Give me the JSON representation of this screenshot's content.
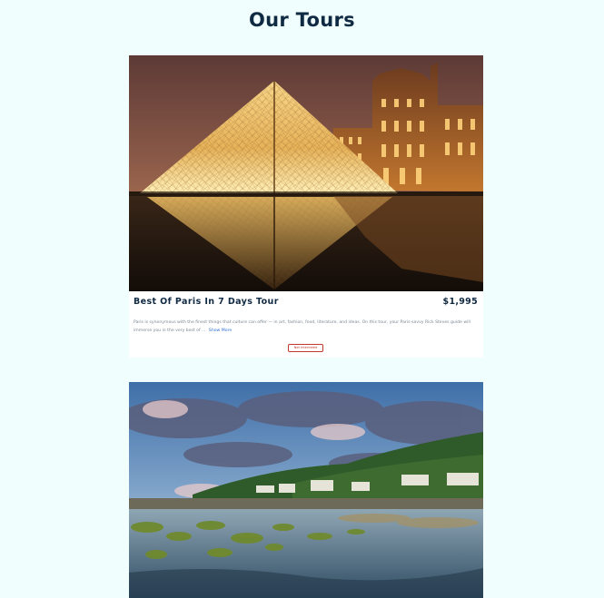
{
  "page": {
    "title": "Our Tours"
  },
  "tours": [
    {
      "name": "Best Of Paris In 7 Days Tour",
      "price": "$1,995",
      "description": "Paris is synonymous with the finest things that culture can offer — in art, fashion, food, literature, and ideas. On this tour, your Paris-savvy Rick Steves guide will immerse you in the very best of ...",
      "show_more_label": "Show More",
      "not_interested_label": "Not Interested",
      "image_subject": "Louvre pyramid at dusk"
    },
    {
      "image_subject": "Seaside town with rocky shore under cloudy sky"
    }
  ]
}
